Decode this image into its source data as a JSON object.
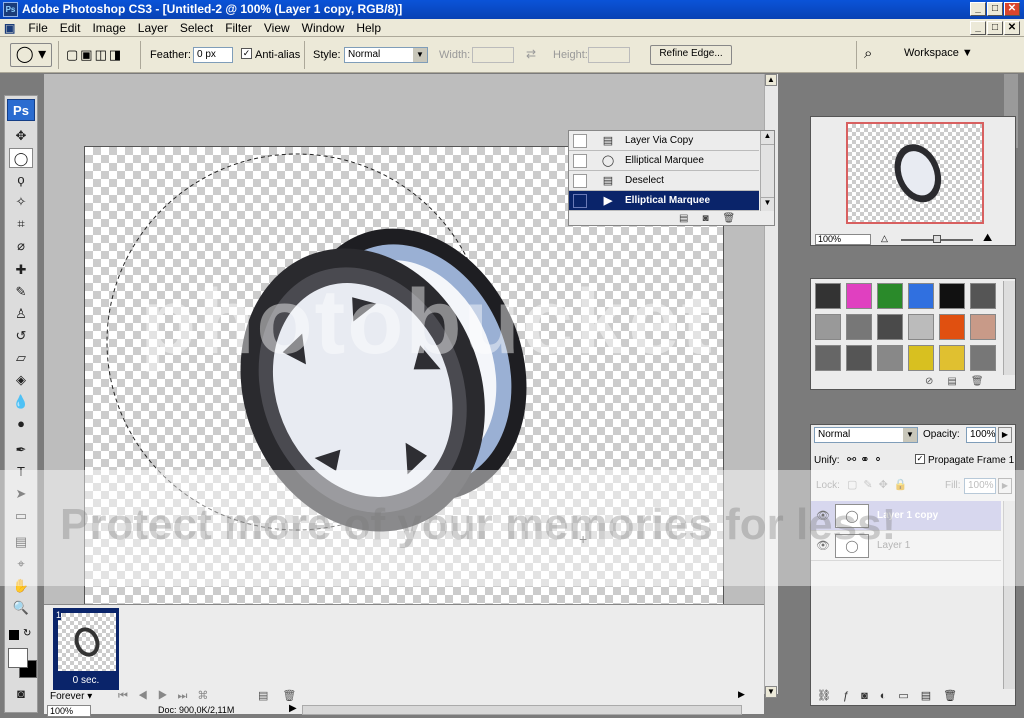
{
  "window": {
    "title": "Adobe Photoshop CS3 - [Untitled-2 @ 100% (Layer 1 copy, RGB/8)]",
    "app_badge": "Ps",
    "minimize": "_",
    "maximize": "□",
    "close": "✕"
  },
  "menu": [
    "File",
    "Edit",
    "Image",
    "Layer",
    "Select",
    "Filter",
    "View",
    "Window",
    "Help"
  ],
  "options": {
    "feather_label": "Feather:",
    "feather_value": "0 px",
    "antialias_label": "Anti-alias",
    "style_label": "Style:",
    "style_value": "Normal",
    "width_label": "Width:",
    "height_label": "Height:",
    "refine_edge": "Refine Edge...",
    "workspace": "Workspace"
  },
  "toolbox": {
    "logo": "Ps"
  },
  "history": {
    "items": [
      {
        "label": "Layer Via Copy",
        "icon": "layer-copy-icon"
      },
      {
        "label": "Elliptical Marquee",
        "icon": "ellipse-marquee-icon"
      },
      {
        "label": "Deselect",
        "icon": "deselect-icon"
      },
      {
        "label": "Elliptical Marquee",
        "icon": "ellipse-marquee-icon",
        "selected": true
      }
    ]
  },
  "animation": {
    "frame_number": "1",
    "frame_delay": "0 sec.",
    "loop": "Forever"
  },
  "status": {
    "zoom": "100%",
    "doc": "Doc: 900,0K/2,11M"
  },
  "navigator": {
    "zoom": "100%"
  },
  "layers": {
    "blend_mode": "Normal",
    "opacity_label": "Opacity:",
    "opacity_value": "100%",
    "unify_label": "Unify:",
    "propagate_label": "Propagate Frame 1",
    "lock_label": "Lock:",
    "fill_label": "Fill:",
    "fill_value": "100%",
    "items": [
      {
        "name": "Layer 1 copy",
        "selected": true
      },
      {
        "name": "Layer 1",
        "selected": false
      }
    ]
  },
  "watermark": {
    "text_top": "photobucket",
    "text_bottom": "Protect more of your memories for less!"
  }
}
